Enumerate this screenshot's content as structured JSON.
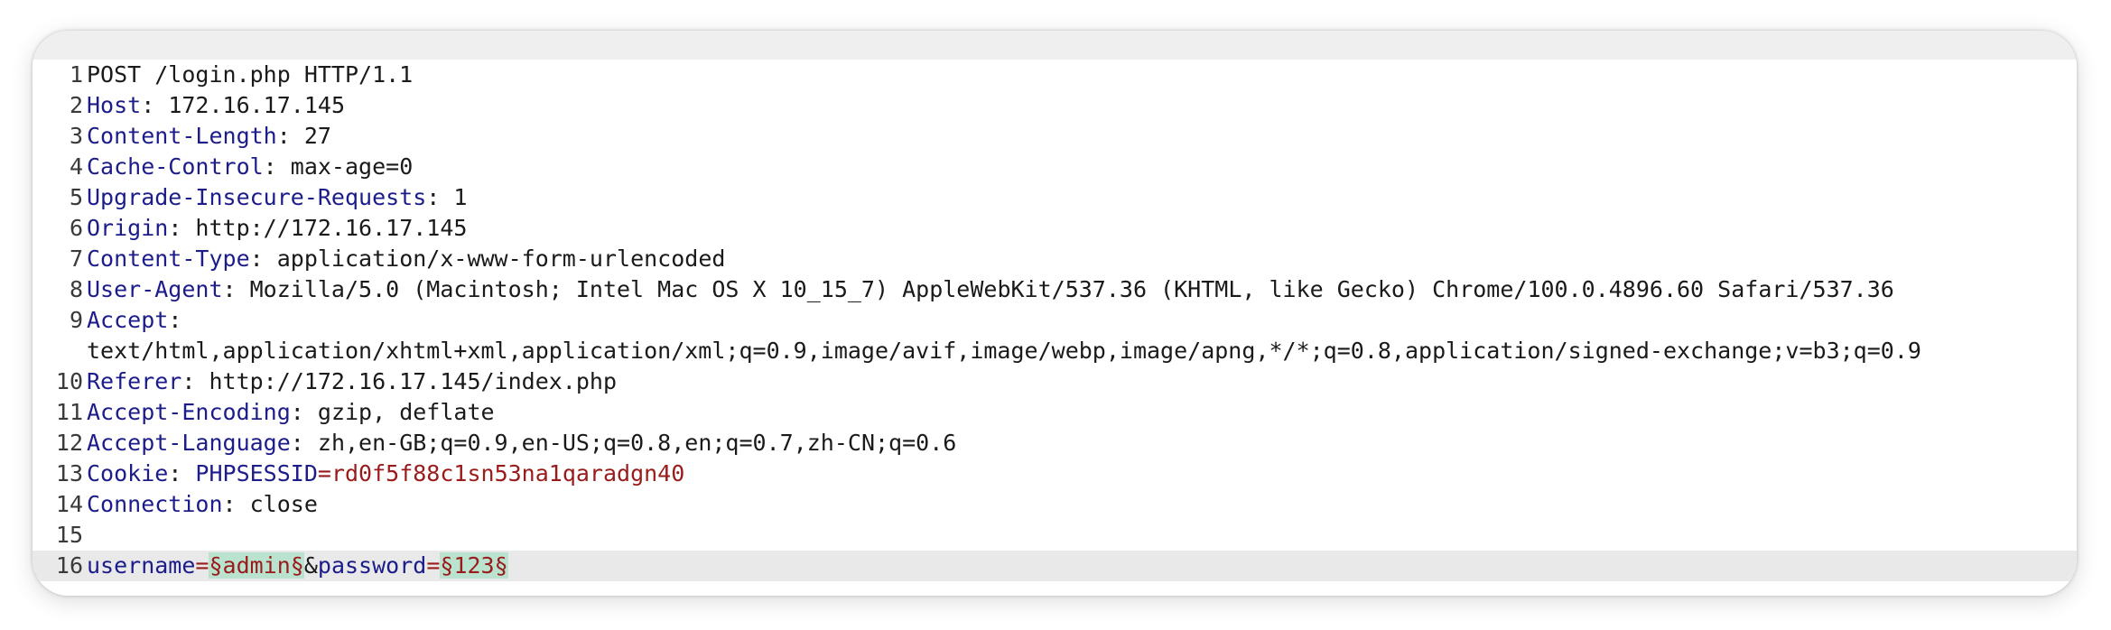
{
  "request_line": "POST /login.php HTTP/1.1",
  "headers": [
    {
      "num": "2",
      "name": "Host",
      "value": "172.16.17.145"
    },
    {
      "num": "3",
      "name": "Content-Length",
      "value": "27"
    },
    {
      "num": "4",
      "name": "Cache-Control",
      "value": "max-age=0"
    },
    {
      "num": "5",
      "name": "Upgrade-Insecure-Requests",
      "value": "1"
    },
    {
      "num": "6",
      "name": "Origin",
      "value": "http://172.16.17.145"
    },
    {
      "num": "7",
      "name": "Content-Type",
      "value": "application/x-www-form-urlencoded"
    },
    {
      "num": "8",
      "name": "User-Agent",
      "value": "Mozilla/5.0 (Macintosh; Intel Mac OS X 10_15_7) AppleWebKit/537.36 (KHTML, like Gecko) Chrome/100.0.4896.60 Safari/537.36"
    }
  ],
  "accept": {
    "num": "9",
    "name": "Accept",
    "value": "text/html,application/xhtml+xml,application/xml;q=0.9,image/avif,image/webp,image/apng,*/*;q=0.8,application/signed-exchange;v=b3;q=0.9"
  },
  "headers2": [
    {
      "num": "10",
      "name": "Referer",
      "value": "http://172.16.17.145/index.php"
    },
    {
      "num": "11",
      "name": "Accept-Encoding",
      "value": "gzip, deflate"
    },
    {
      "num": "12",
      "name": "Accept-Language",
      "value": "zh,en-GB;q=0.9,en-US;q=0.8,en;q=0.7,zh-CN;q=0.6"
    }
  ],
  "cookie": {
    "num": "13",
    "name": "Cookie",
    "key": "PHPSESSID",
    "value": "rd0f5f88c1sn53na1qaradgn40"
  },
  "connection": {
    "num": "14",
    "name": "Connection",
    "value": "close"
  },
  "blank": {
    "num": "15"
  },
  "body": {
    "num": "16",
    "param1_name": "username",
    "param1_value": "§admin§",
    "param2_name": "password",
    "param2_value": "§123§"
  },
  "line_numbers": {
    "first": "1"
  },
  "colors": {
    "header_name": "#1c1c8a",
    "cookie_value": "#9a1b1b",
    "payload_highlight": "#b9e3cf",
    "current_line": "#e9e9e9"
  }
}
